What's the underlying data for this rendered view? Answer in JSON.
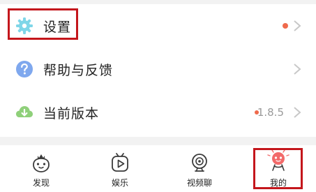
{
  "menu": {
    "items": [
      {
        "label": "设置",
        "icon": "gear-icon",
        "has_dot": true
      },
      {
        "label": "帮助与反馈",
        "icon": "help-icon",
        "has_dot": false
      },
      {
        "label": "当前版本",
        "icon": "cloud-download-icon",
        "has_dot": true,
        "value": "1.8.5"
      }
    ]
  },
  "tabbar": {
    "tabs": [
      {
        "label": "发现",
        "icon": "strawberry-icon"
      },
      {
        "label": "娱乐",
        "icon": "tv-play-icon"
      },
      {
        "label": "视频聊",
        "icon": "webcam-icon"
      },
      {
        "label": "我的",
        "icon": "profile-mascot-icon",
        "active": true
      }
    ]
  },
  "colors": {
    "accent_dot": "#ef6a4c",
    "gear_icon": "#7fd6e8",
    "help_icon": "#7fa8ee",
    "download_icon": "#8fd07a",
    "highlight_border": "#c4161c",
    "mascot": "#f26a6a"
  }
}
